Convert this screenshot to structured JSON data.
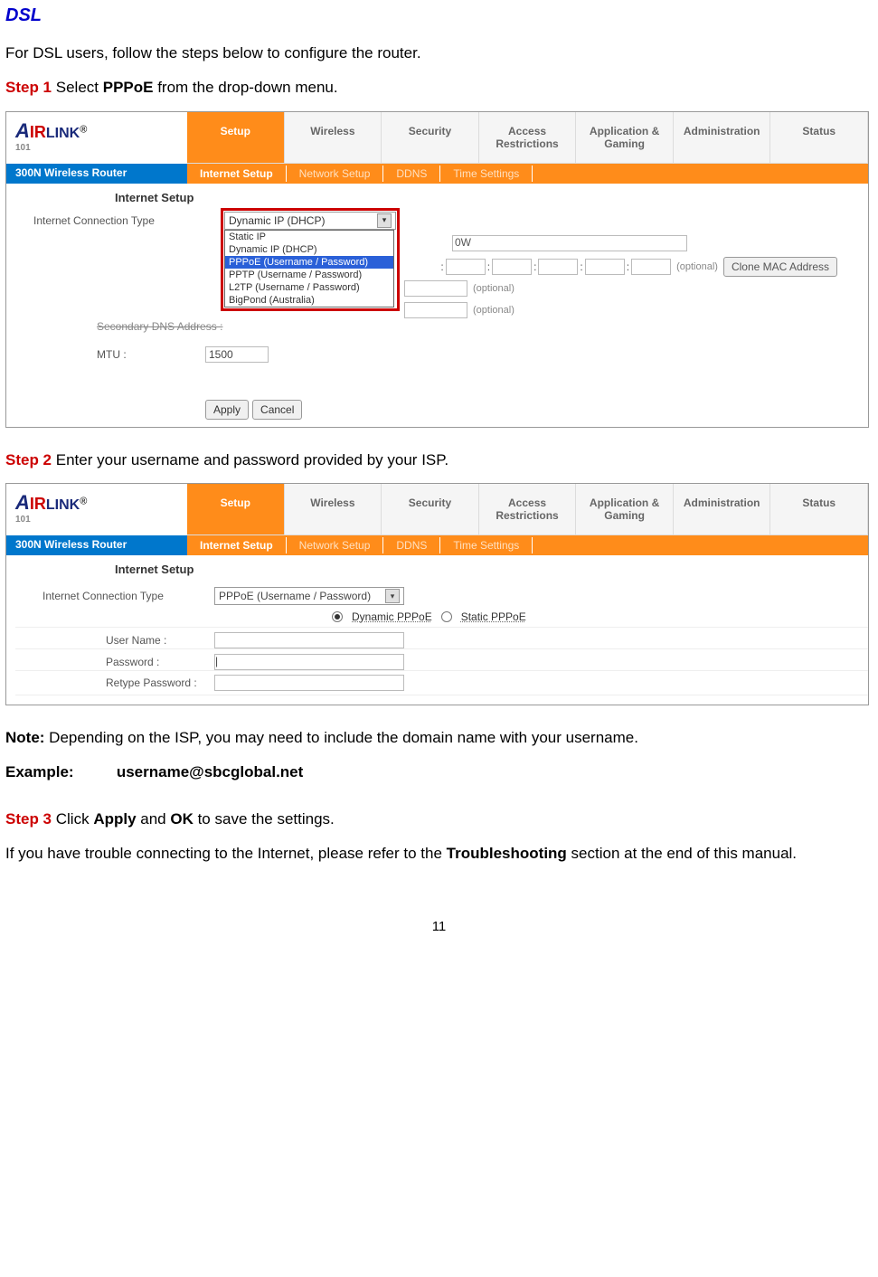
{
  "headings": {
    "dsl": "DSL",
    "note_label": "Note:",
    "example_label": "Example:",
    "example_value": "username@sbcglobal.net"
  },
  "paragraphs": {
    "intro": "For DSL users, follow the steps below to configure the router.",
    "step1_label": "Step 1",
    "step1_text": " Select ",
    "step1_bold": "PPPoE",
    "step1_tail": " from the drop-down menu.",
    "step2_label": "Step 2",
    "step2_text": " Enter your username and password provided by your ISP.",
    "note_text": " Depending on the ISP, you may need to include the domain name with your username.",
    "step3_label": "Step 3",
    "step3_a": " Click ",
    "step3_apply": "Apply",
    "step3_and": " and ",
    "step3_ok": "OK",
    "step3_tail": " to save the settings.",
    "trouble_a": "If you have trouble connecting to the Internet, please refer to the ",
    "trouble_b": "Troubleshooting",
    "trouble_c": " section at the end of this manual.",
    "page_number": "11"
  },
  "router_ui": {
    "logo": {
      "brand_a": "A",
      "brand_ir": "IR",
      "brand_link": "LINK",
      "sub": "101",
      "reg": "®"
    },
    "tabs": [
      "Setup",
      "Wireless",
      "Security",
      "Access Restrictions",
      "Application & Gaming",
      "Administration",
      "Status"
    ],
    "router_name": "300N Wireless Router",
    "subnav": [
      "Internet Setup",
      "Network Setup",
      "DDNS",
      "Time Settings"
    ],
    "section": "Internet Setup",
    "conn_label": "Internet Connection Type",
    "dropdown_value_1": "Dynamic IP (DHCP)",
    "dropdown_options": [
      "Static IP",
      "Dynamic IP (DHCP)",
      "PPPoE (Username / Password)",
      "PPTP (Username / Password)",
      "L2TP (Username / Password)",
      "BigPond (Australia)"
    ],
    "behind_host": "0W",
    "secondary_dns": "Secondary DNS Address :",
    "mtu_label": "MTU :",
    "mtu_value": "1500",
    "optional": "(optional)",
    "clone_mac": "Clone MAC Address",
    "apply": "Apply",
    "cancel": "Cancel",
    "dropdown_value_2": "PPPoE (Username / Password)",
    "radio_dynamic": "Dynamic PPPoE",
    "radio_static": "Static PPPoE",
    "username_label": "User Name :",
    "password_label": "Password :",
    "retype_label": "Retype Password :"
  }
}
